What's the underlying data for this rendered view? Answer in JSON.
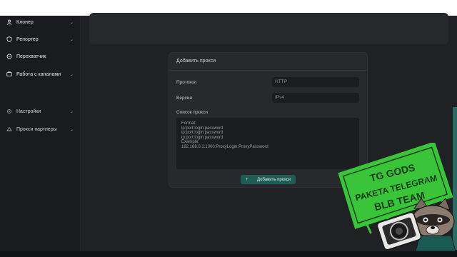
{
  "sidebar": {
    "items": [
      {
        "label": "Клонер",
        "icon": "user-icon",
        "has_chevron": true
      },
      {
        "label": "Репортер",
        "icon": "shield-icon",
        "has_chevron": true
      },
      {
        "label": "Перехватчик",
        "icon": "intercept-icon",
        "has_chevron": false
      },
      {
        "label": "Работа с каналами",
        "icon": "channel-icon",
        "has_chevron": true
      },
      {
        "label": "Настройки",
        "icon": "gear-icon",
        "has_chevron": true
      },
      {
        "label": "Прокси партнеры",
        "icon": "proxy-icon",
        "has_chevron": true
      }
    ]
  },
  "proxy_card": {
    "title": "Добавить прокси",
    "protocol_label": "Протокол",
    "protocol_value": "HTTP",
    "version_label": "Версия",
    "version_value": "IPv4",
    "list_label": "Список прокси",
    "list_placeholder": "Format:\nip:port:login:password\nip:port:login:password\nip:port:login:password\nExample:\n192.168.0.1:1000:ProxyLogin:ProxyPassword",
    "add_button_label": "Добавить прокси",
    "add_button_icon": "+"
  },
  "sticker": {
    "line1": "TG GODS",
    "line2": "PAKETA TELEGRAM",
    "line3": "BLB TEAM"
  },
  "colors": {
    "accent": "#1e5c55",
    "background": "#1f2124",
    "sidebar": "#1a1b1e",
    "card": "#27292d",
    "sticker_green": "#39c43a"
  }
}
